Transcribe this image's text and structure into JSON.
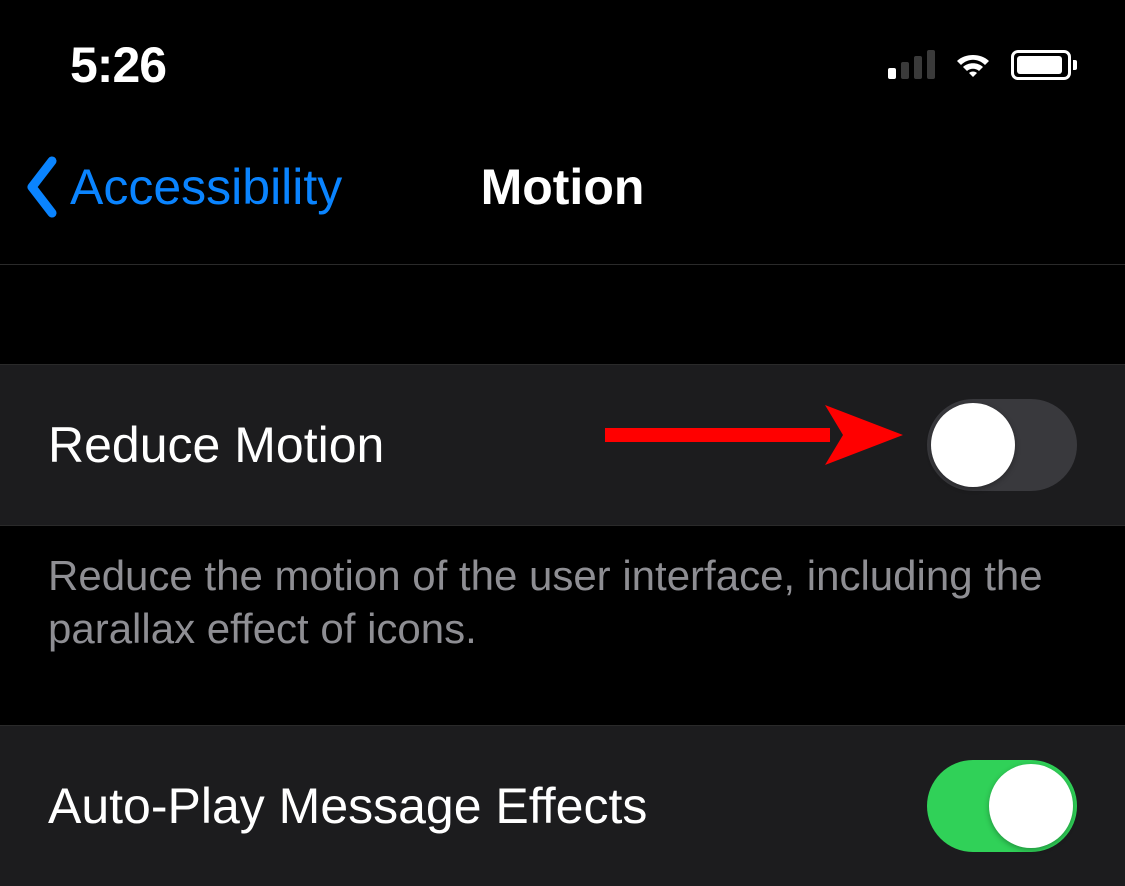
{
  "status_bar": {
    "time": "5:26",
    "cellular_signal_bars": 1,
    "cellular_total_bars": 4,
    "wifi_on": true,
    "battery_level_pct": 90
  },
  "nav": {
    "back_label": "Accessibility",
    "title": "Motion"
  },
  "settings": {
    "reduce_motion": {
      "label": "Reduce Motion",
      "enabled": false,
      "description": "Reduce the motion of the user interface, including the parallax effect of icons."
    },
    "auto_play_message_effects": {
      "label": "Auto-Play Message Effects",
      "enabled": true
    }
  },
  "annotation": {
    "type": "arrow",
    "color": "#ff0000",
    "points_to": "reduce-motion-toggle"
  }
}
